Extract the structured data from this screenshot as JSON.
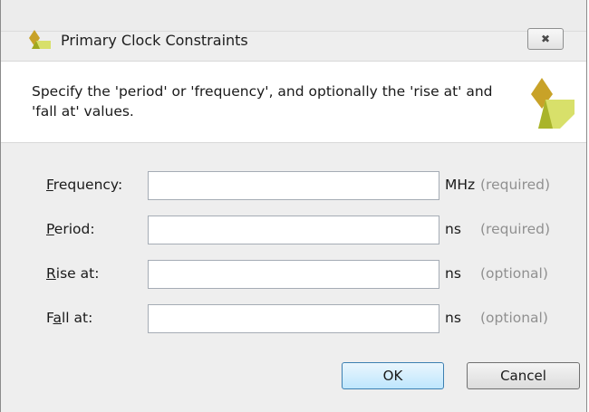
{
  "window": {
    "title": "Primary Clock Constraints",
    "close_symbol": "✖",
    "logo_icon": "xilinx-logo-icon"
  },
  "header": {
    "description": "Specify the 'period' or 'frequency', and optionally the 'rise at' and 'fall at' values."
  },
  "fields": [
    {
      "label_mnemonic": "F",
      "label_rest": "requency:",
      "value": "",
      "unit": "MHz",
      "note": "(required)"
    },
    {
      "label_mnemonic": "P",
      "label_rest": "eriod:",
      "value": "",
      "unit": "ns",
      "note": "(required)"
    },
    {
      "label_mnemonic": "R",
      "label_rest": "ise at:",
      "value": "",
      "unit": "ns",
      "note": "(optional)"
    },
    {
      "label_pre": "F",
      "label_mnemonic": "a",
      "label_rest": "ll at:",
      "value": "",
      "unit": "ns",
      "note": "(optional)"
    }
  ],
  "buttons": {
    "ok": "OK",
    "cancel": "Cancel"
  },
  "colors": {
    "logo_dark": "#c8a228",
    "logo_light": "#d8e06a",
    "ok_border": "#3c7fb1"
  }
}
